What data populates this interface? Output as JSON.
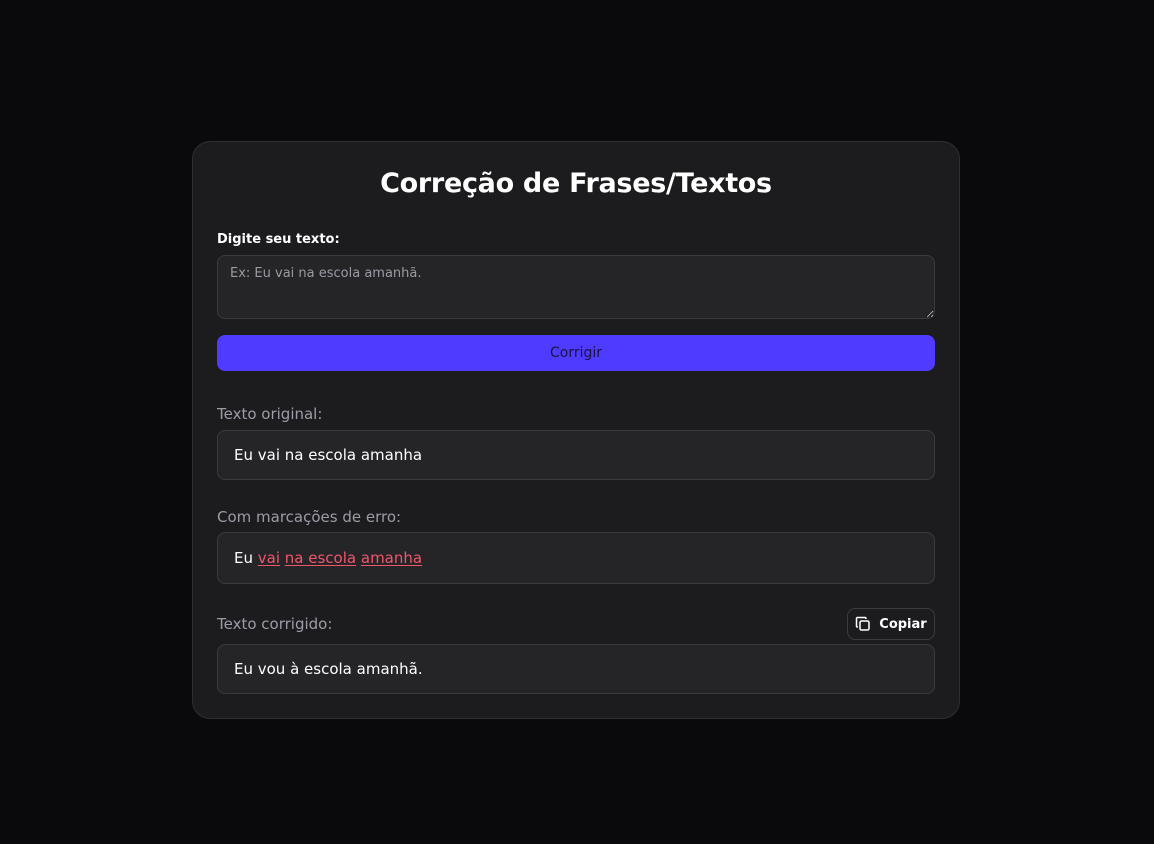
{
  "title": "Correção de Frases/Textos",
  "input": {
    "label": "Digite seu texto:",
    "placeholder": "Ex: Eu vai na escola amanhã.",
    "value": ""
  },
  "submit_label": "Corrigir",
  "original": {
    "label": "Texto original:",
    "text": "Eu vai na escola amanha"
  },
  "marked": {
    "label": "Com marcações de erro:",
    "segments": [
      {
        "text": "Eu",
        "error": false
      },
      {
        "text": "vai",
        "error": true
      },
      {
        "text": "na escola",
        "error": true
      },
      {
        "text": "amanha",
        "error": true
      }
    ]
  },
  "corrected": {
    "label": "Texto corrigido:",
    "copy_label": "Copiar",
    "copy_icon": "copy-icon",
    "text": "Eu vou à escola amanhã."
  },
  "colors": {
    "accent": "#4f3aff",
    "error": "#f0566a",
    "background": "#0a0a0c",
    "card": "#1c1c1f"
  }
}
